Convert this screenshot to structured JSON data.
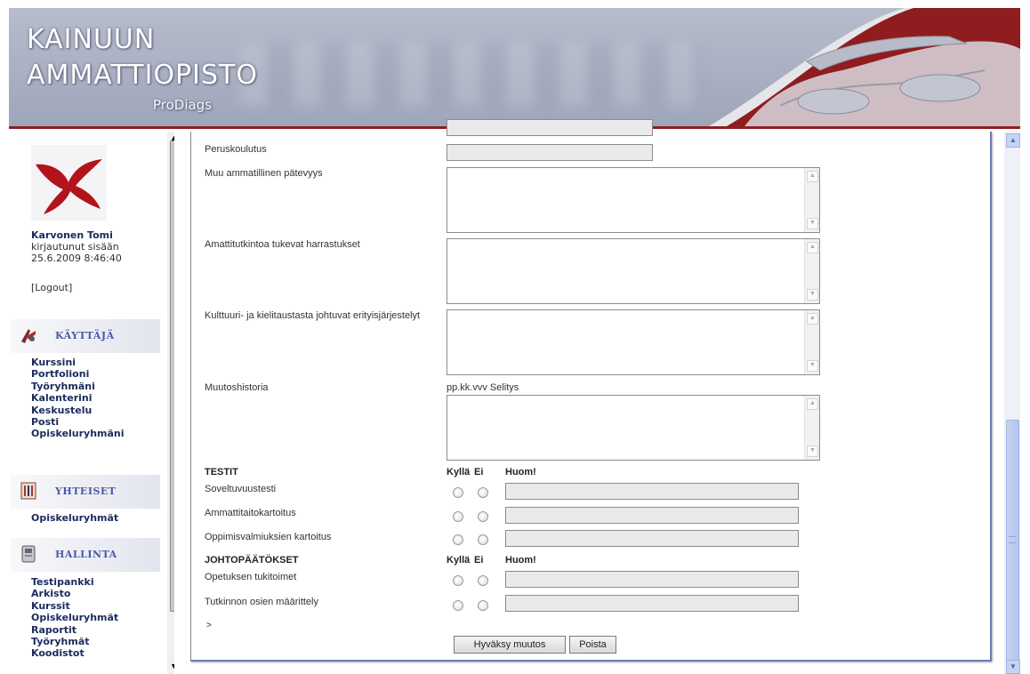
{
  "header": {
    "title_line1": "KAINUUN",
    "title_line2": "AMMATTIOPISTO",
    "subtitle": "ProDiags",
    "accent_color": "#8e1d20"
  },
  "sidebar": {
    "user": {
      "name": "Karvonen Tomi",
      "status": "kirjautunut sisään",
      "login_time": "25.6.2009 8:46:40"
    },
    "logout_label": "[Logout]",
    "sections": [
      {
        "label": "KÄYTTÄJÄ",
        "icon": "user-tools-icon",
        "items": [
          "Kurssini",
          "Portfolioni",
          "Työryhmäni",
          "Kalenterini",
          "Keskustelu",
          "Posti",
          "Opiskeluryhmäni"
        ]
      },
      {
        "label": "YHTEISET",
        "icon": "bookshelf-icon",
        "items": [
          "Opiskeluryhmät"
        ]
      },
      {
        "label": "HALLINTA",
        "icon": "admin-icon",
        "items": [
          "Testipankki",
          "Arkisto",
          "Kurssit",
          "Opiskeluryhmät",
          "Raportit",
          "Työryhmät",
          "Koodistot"
        ]
      }
    ]
  },
  "form": {
    "fields": {
      "peruskoulutus": {
        "label": "Peruskoulutus",
        "value": ""
      },
      "muu_patevyys": {
        "label": "Muu ammatillinen pätevyys",
        "value": ""
      },
      "harrastukset": {
        "label": "Amattitutkintoa tukevat harrastukset",
        "value": ""
      },
      "erityisjarjestelyt": {
        "label": "Kulttuuri- ja kielitaustasta johtuvat erityisjärjestelyt",
        "value": ""
      },
      "muutoshistoria": {
        "label": "Muutoshistoria",
        "hint": "pp.kk.vvv Selitys",
        "value": ""
      }
    },
    "testit": {
      "heading": "TESTIT",
      "col_yes": "Kyllä",
      "col_no": "Ei",
      "col_note": "Huom!",
      "rows": [
        {
          "label": "Soveltuvuustesti",
          "note": ""
        },
        {
          "label": "Ammattitaitokartoitus",
          "note": ""
        },
        {
          "label": "Oppimisvalmiuksien kartoitus",
          "note": ""
        }
      ]
    },
    "johtopaatokset": {
      "heading": "JOHTOPÄÄTÖKSET",
      "col_yes": "Kyllä",
      "col_no": "Ei",
      "col_note": "Huom!",
      "rows": [
        {
          "label": "Opetuksen tukitoimet",
          "note": ""
        },
        {
          "label": "Tutkinnon osien määrittely",
          "note": ""
        }
      ]
    },
    "marker": ">",
    "buttons": {
      "accept": "Hyväksy muutos",
      "delete": "Poista"
    }
  }
}
